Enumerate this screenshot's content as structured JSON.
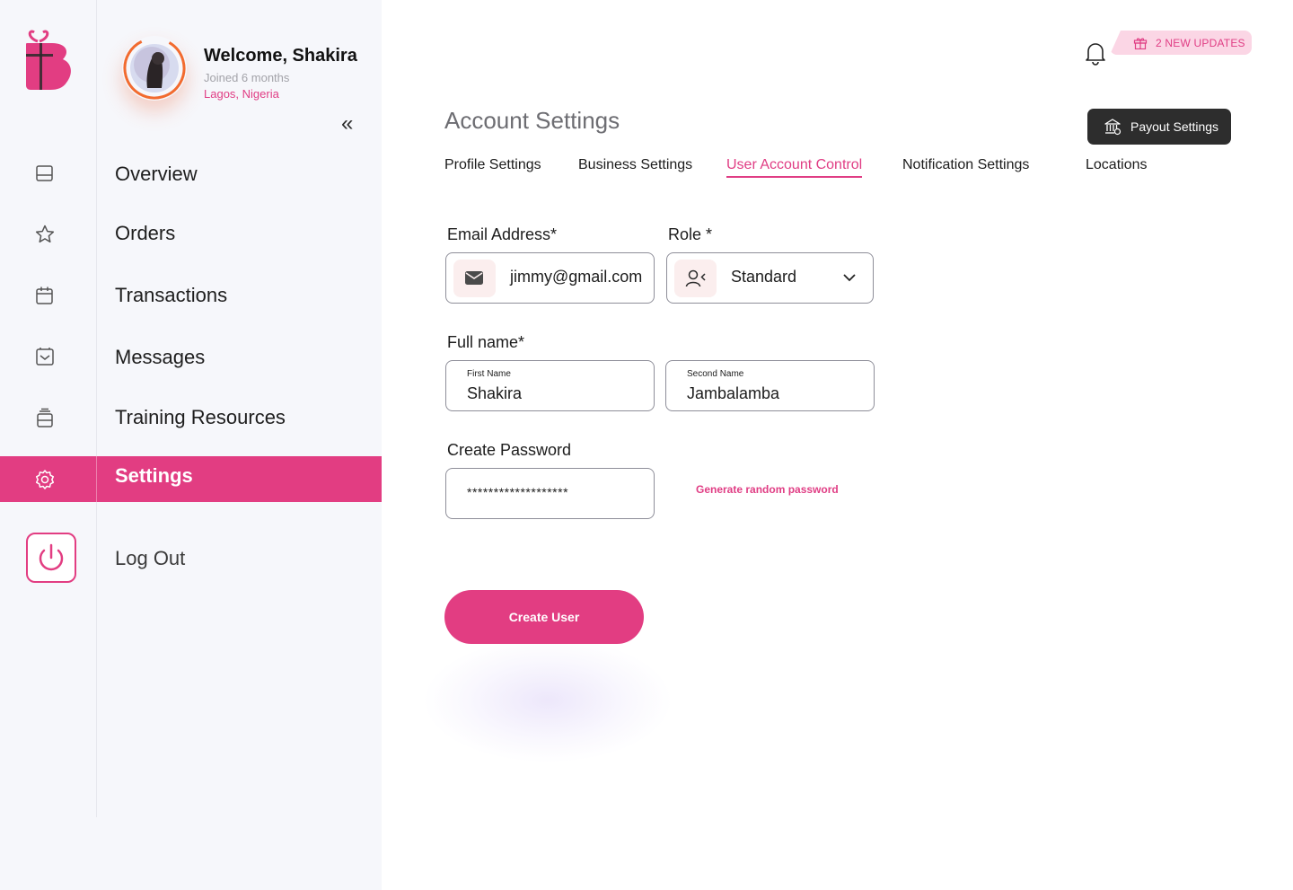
{
  "profile": {
    "welcome": "Welcome, Shakira",
    "joined": "Joined 6 months",
    "location": "Lagos, Nigeria"
  },
  "sidebar": {
    "collapse_symbol": "«",
    "items": [
      {
        "label": "Overview",
        "icon": "inbox-icon"
      },
      {
        "label": "Orders",
        "icon": "star-icon"
      },
      {
        "label": "Transactions",
        "icon": "calendar-icon"
      },
      {
        "label": "Messages",
        "icon": "message-box-icon"
      },
      {
        "label": "Training Resources",
        "icon": "stack-icon"
      },
      {
        "label": "Settings",
        "icon": "gear-icon",
        "active": true
      }
    ],
    "logout_label": "Log Out"
  },
  "header": {
    "updates_label": "2 NEW UPDATES",
    "page_title": "Account Settings",
    "payout_label": "Payout Settings"
  },
  "tabs": [
    {
      "label": "Profile Settings"
    },
    {
      "label": "Business Settings"
    },
    {
      "label": "User Account Control",
      "active": true
    },
    {
      "label": "Notification Settings"
    },
    {
      "label": "Locations"
    }
  ],
  "form": {
    "email_label": "Email Address*",
    "email_value": "jimmy@gmail.com",
    "role_label": "Role *",
    "role_value": "Standard",
    "fullname_label": "Full name*",
    "first_name_label": "First Name",
    "first_name_value": "Shakira",
    "second_name_label": "Second Name",
    "second_name_value": "Jambalamba",
    "password_label": "Create Password",
    "password_value": "*******************",
    "generate_link": "Generate random password",
    "submit_label": "Create User"
  },
  "colors": {
    "accent": "#e23d82",
    "sidebar_bg": "#f6f7fb",
    "dark_button": "#2d2d2d",
    "updates_bg": "#fbd6e5",
    "avatar_ring": "#f26b2f"
  }
}
